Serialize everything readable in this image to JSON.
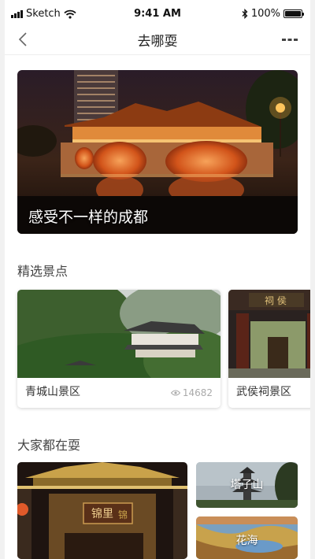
{
  "status_bar": {
    "carrier": "Sketch",
    "time": "9:41 AM",
    "battery": "100%"
  },
  "nav": {
    "title": "去哪耍"
  },
  "hero": {
    "caption": "感受不一样的成都"
  },
  "featured": {
    "title": "精选景点",
    "cards": [
      {
        "name": "青城山景区",
        "views": "14682"
      },
      {
        "name": "武侯祠景区"
      }
    ]
  },
  "popular": {
    "title": "大家都在耍",
    "tiles": [
      {
        "sign": "锦里",
        "sign_char": "锦"
      },
      {
        "label": "塔子山"
      },
      {
        "label": "花海"
      }
    ]
  },
  "colors": {
    "accent": "#ff6a00"
  },
  "icons": {
    "back": "chevron-left-icon",
    "more": "more-dots-icon",
    "views": "eye-icon",
    "wifi": "wifi-icon",
    "bluetooth": "bluetooth-icon"
  }
}
